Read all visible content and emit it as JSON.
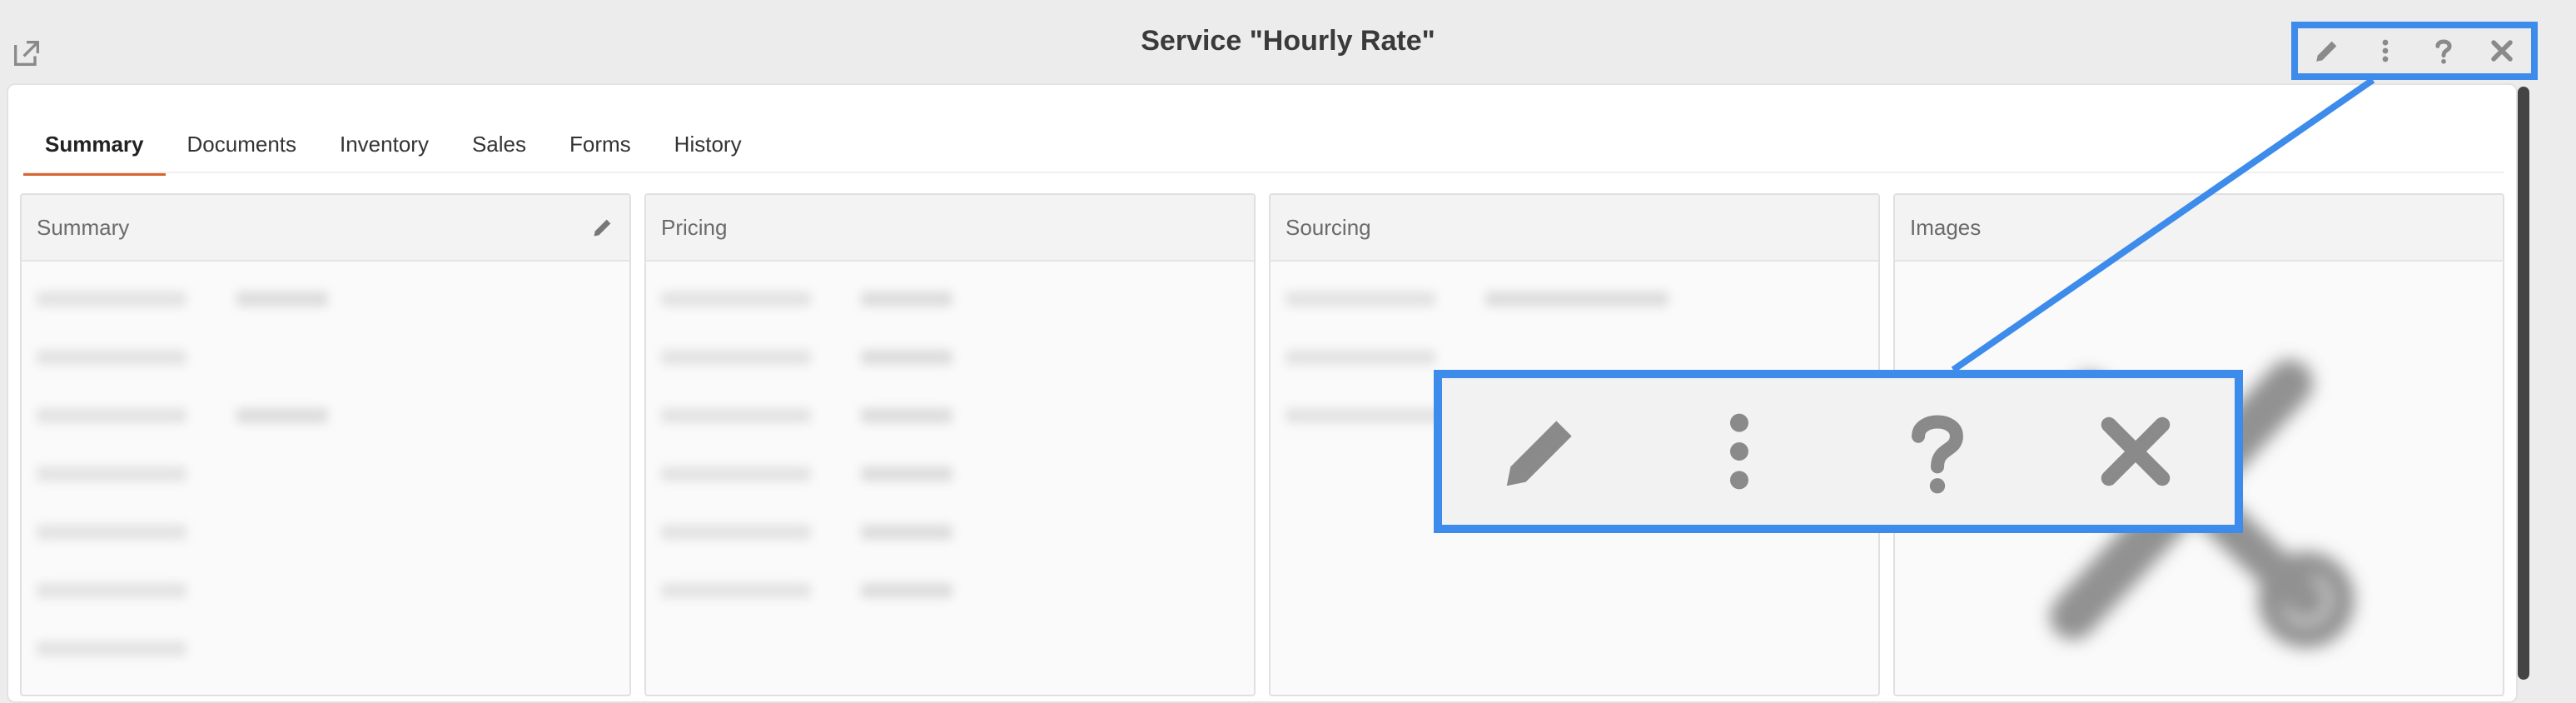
{
  "window": {
    "title": "Service \"Hourly Rate\""
  },
  "toolbar": {
    "icons": [
      "pencil-icon",
      "more-vertical-icon",
      "help-icon",
      "close-icon"
    ]
  },
  "tabs": [
    {
      "label": "Summary",
      "active": true
    },
    {
      "label": "Documents",
      "active": false
    },
    {
      "label": "Inventory",
      "active": false
    },
    {
      "label": "Sales",
      "active": false
    },
    {
      "label": "Forms",
      "active": false
    },
    {
      "label": "History",
      "active": false
    }
  ],
  "cards": {
    "summary": {
      "title": "Summary"
    },
    "pricing": {
      "title": "Pricing"
    },
    "sourcing": {
      "title": "Sourcing"
    },
    "images": {
      "title": "Images"
    }
  },
  "colors": {
    "accent": "#d9642e",
    "highlight": "#3d8bea",
    "icon": "#8a8a8a"
  }
}
